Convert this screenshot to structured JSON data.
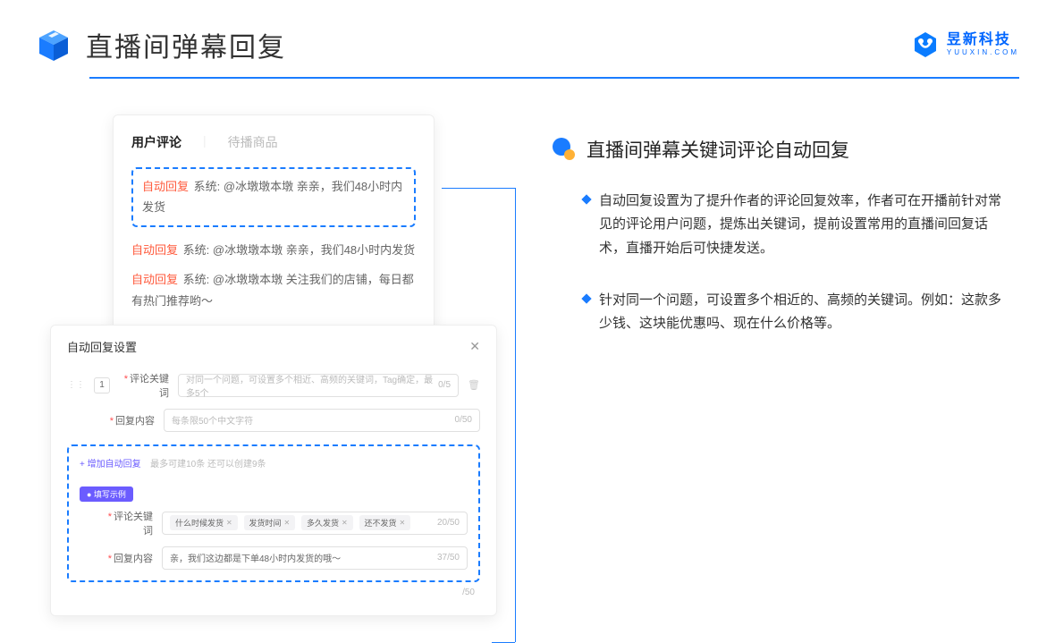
{
  "header": {
    "title": "直播间弹幕回复",
    "logo_cn": "昱新科技",
    "logo_en": "YUUXIN.COM"
  },
  "comment_card": {
    "tab_active": "用户评论",
    "tab_inactive": "待播商品",
    "auto_label": "自动回复",
    "sys_label": "系统:",
    "line1": "@冰墩墩本墩 亲亲，我们48小时内发货",
    "line2": "@冰墩墩本墩 亲亲，我们48小时内发货",
    "line3": "@冰墩墩本墩 关注我们的店铺，每日都有热门推荐哟～"
  },
  "settings": {
    "title": "自动回复设置",
    "order": "1",
    "kw_label": "评论关键词",
    "kw_placeholder": "对同一个问题，可设置多个相近、高频的关键词，Tag确定，最多5个",
    "kw_counter": "0/5",
    "content_label": "回复内容",
    "content_placeholder": "每条限50个中文字符",
    "content_counter": "0/50",
    "add_link": "+ 增加自动回复",
    "add_hint": "最多可建10条 还可以创建9条",
    "example_tag": "● 填写示例",
    "ex_kw_label": "评论关键词",
    "ex_tags": [
      "什么时候发货",
      "发货时间",
      "多久发货",
      "还不发货"
    ],
    "ex_kw_counter": "20/50",
    "ex_content_label": "回复内容",
    "ex_content_value": "亲，我们这边都是下单48小时内发货的哦～",
    "ex_content_counter": "37/50",
    "bottom_counter": "/50"
  },
  "right": {
    "section_title": "直播间弹幕关键词评论自动回复",
    "bullet1": "自动回复设置为了提升作者的评论回复效率，作者可在开播前针对常见的评论用户问题，提炼出关键词，提前设置常用的直播间回复话术，直播开始后可快捷发送。",
    "bullet2": "针对同一个问题，可设置多个相近的、高频的关键词。例如：这款多少钱、这块能优惠吗、现在什么价格等。"
  }
}
